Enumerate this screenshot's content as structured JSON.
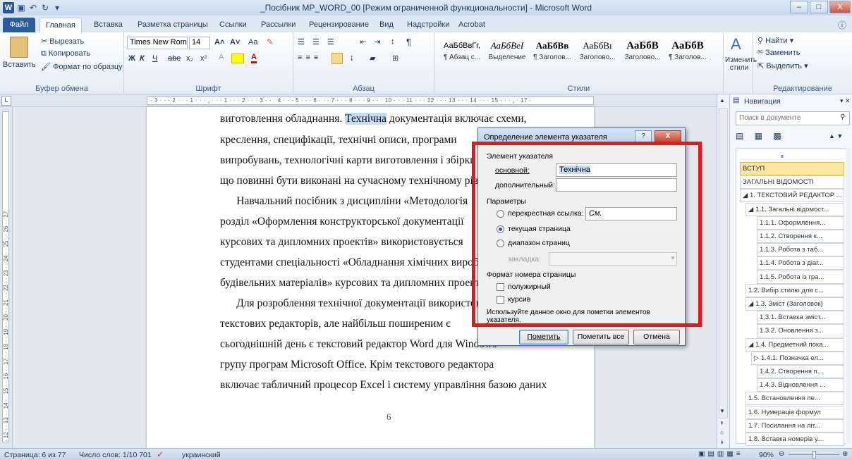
{
  "window": {
    "title": "_Посібник МР_WORD_00 [Режим ограниченной функциональности] - Microsoft Word",
    "logo": "W",
    "min": "–",
    "max": "□",
    "close": "X"
  },
  "tabs": [
    "Файл",
    "Главная",
    "Вставка",
    "Разметка страницы",
    "Ссылки",
    "Рассылки",
    "Рецензирование",
    "Вид",
    "Надстройки",
    "Acrobat"
  ],
  "clipboard": {
    "paste": "Вставить",
    "cut": "Вырезать",
    "copy": "Копировать",
    "format_painter": "Формат по образцу",
    "label": "Буфер обмена"
  },
  "font": {
    "name": "Times New Rom",
    "size": "14",
    "label": "Шрифт",
    "bold": "Ж",
    "italic": "К",
    "underline": "Ч",
    "strike": "abe",
    "sub": "x₂",
    "sup": "x²",
    "grow": "A˄",
    "shrink": "A˅",
    "case": "Aa"
  },
  "paragraph": {
    "label": "Абзац",
    "pilcrow": "¶"
  },
  "styles": {
    "label": "Стили",
    "items": [
      {
        "sample": "АаБбВвГг,",
        "name": "¶ Абзац с..."
      },
      {
        "sample": "АаБбВеI",
        "name": "Выделение"
      },
      {
        "sample": "АаБбВв",
        "name": "¶ Заголов..."
      },
      {
        "sample": "АаБбВı",
        "name": "Заголово..."
      },
      {
        "sample": "АаБбВ",
        "name": "Заголово..."
      },
      {
        "sample": "АаБбВ",
        "name": "¶ Заголов..."
      }
    ],
    "change": "Изменить стили"
  },
  "editing": {
    "label": "Редактирование",
    "find": "Найти",
    "replace": "Заменить",
    "select": "Выделить"
  },
  "ruler": "· 3 · · · 2 · · · 1 · · · ⁁ · · · 1 · · · 2 · · · 3 · · · 4 · · · 5 · · · 6 · · · 7 · · · 8 · · · 9 · · · 10 · · · 11 · · · 12 · · · 13 · · · 14 · · · 15 · · · ⁁ · 17 ·",
  "vruler": "· 12 · · 13 · · 14 · · 15 · · 16 · · 17 · · 18 · · 19 · · 20 · · 21 · · 22 · · 23 · · 24 · · 25 · · 26 · · 27",
  "document": {
    "line1a": "виготовлення обладнання.",
    "line1b": "Технічна",
    "line1c": "документація включає схеми,",
    "lines": [
      "креслення, специфікації, технічні описи, програми",
      "випробувань, технологічні карти виготовлення і збірки та",
      "що повинні бути виконані на сучасному технічному рівні",
      "      Навчальний посібник з дисципліни «Методологія",
      "розділ «Оформлення конструкторської документації",
      "курсових та дипломних проектів» використовується",
      "студентами спеціальності «Обладнання хімічних виробництв",
      "будівельних матеріалів» курсових та дипломних проектів",
      "      Для розроблення технічної документації використовують",
      "текстових редакторів, але найбільш поширеним є",
      "сьогоднішній день є текстовий редактор Word для Windows",
      "групу програм Microsoft Office. Крім текстового редактора",
      "включає табличний процесор Excel і систему управління базою даних"
    ],
    "page_number": "6"
  },
  "dialog": {
    "title": "Определение элемента указателя",
    "help": "?",
    "close": "X",
    "section_entry": "Элемент указателя",
    "main_label": "основной:",
    "main_value": "Технічна",
    "sub_label": "дополнительный:",
    "sub_value": "",
    "section_options": "Параметры",
    "cross_ref": "перекрестная ссылка:",
    "cross_ref_value": "См.",
    "current_page": "текущая страница",
    "page_range": "диапазон страниц",
    "bookmark": "закладка:",
    "section_format": "Формат номера страницы",
    "bold": "полужирный",
    "italic": "курсив",
    "note": "Используйте данное окно для пометки элементов указателя.",
    "mark": "Пометить",
    "mark_all": "Пометить все",
    "cancel": "Отмена"
  },
  "nav": {
    "title": "Навигация",
    "search_placeholder": "Поиск в документе",
    "items": [
      {
        "text": "ВСТУП",
        "active": true
      },
      {
        "text": "ЗАГАЛЬНІ ВІДОМОСТІ"
      },
      {
        "text": "◢ 1. ТЕКСТОВИЙ РЕДАКТОР ..."
      },
      {
        "text": "◢ 1.1. Загальні відомост..."
      },
      {
        "text": "1.1.1. Оформлення..."
      },
      {
        "text": "1.1.2. Створення к..."
      },
      {
        "text": "1.1.3. Робота з таб..."
      },
      {
        "text": "1.1.4. Робота з діаг..."
      },
      {
        "text": "1.1.5. Робота із гра..."
      },
      {
        "text": "1.2. Вибір стилю для с..."
      },
      {
        "text": "◢ 1.3. Зміст (Заголовок)"
      },
      {
        "text": "1.3.1. Вставка зміст..."
      },
      {
        "text": "1.3.2. Оновлення з..."
      },
      {
        "text": "◢ 1.4. Предметний пока..."
      },
      {
        "text": "▷ 1.4.1. Позначка ел..."
      },
      {
        "text": "1.4.2. Створення п..."
      },
      {
        "text": "1.4.3. Відновлення ..."
      },
      {
        "text": "1.5. Встановлення пе..."
      },
      {
        "text": "1.6. Нумерація формул"
      },
      {
        "text": "1.7. Посилання на літ..."
      },
      {
        "text": "1.8. Вставка номерів у..."
      }
    ]
  },
  "status": {
    "page": "Страница: 6 из 77",
    "words": "Число слов: 1/10 701",
    "language": "украинский",
    "zoom": "90%"
  }
}
